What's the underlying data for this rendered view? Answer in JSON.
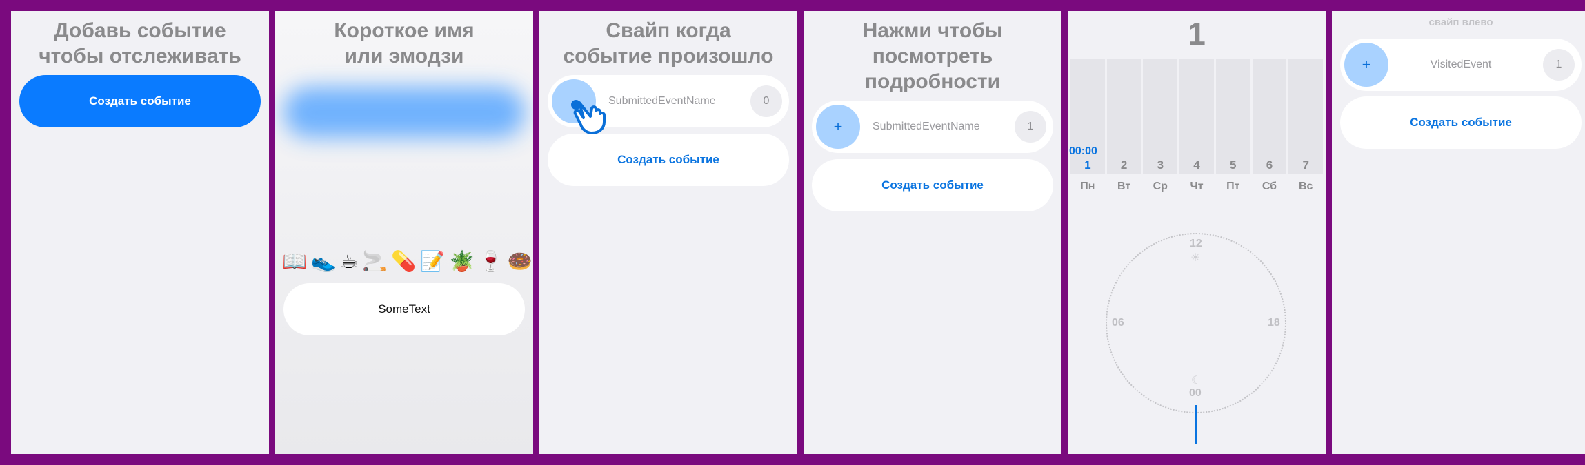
{
  "panel1": {
    "title_line1": "Добавь событие",
    "title_line2": "чтобы отслеживать",
    "create_button": "Создать событие"
  },
  "panel2": {
    "title_line1": "Короткое имя",
    "title_line2": "или эмодзи",
    "emojis": "📖👟☕🚬💊📝🪴🍷🍩",
    "input_value": "SomeText"
  },
  "panel3": {
    "title_line1": "Свайп когда",
    "title_line2": "событие произошло",
    "event_name": "SubmittedEventName",
    "event_count": "0",
    "create_button": "Создать событие"
  },
  "panel4": {
    "title_line1": "Нажми чтобы",
    "title_line2": "посмотреть",
    "title_line3": "подробности",
    "event_icon": "+",
    "event_name": "SubmittedEventName",
    "event_count": "1",
    "create_button": "Создать событие"
  },
  "panel5": {
    "total": "1",
    "time_label": "00:00",
    "days": [
      "1",
      "2",
      "3",
      "4",
      "5",
      "6",
      "7"
    ],
    "day_names": [
      "Пн",
      "Вт",
      "Ср",
      "Чт",
      "Пт",
      "Сб",
      "Вс"
    ],
    "clock": {
      "top": "12",
      "left": "06",
      "right": "18",
      "bottom": "00"
    }
  },
  "panel6": {
    "hint": "свайп влево",
    "event_icon": "+",
    "event_name": "VisitedEvent",
    "event_count": "1",
    "create_button": "Создать событие"
  },
  "colors": {
    "accent": "#0a7bff",
    "frame": "#7a0a7e",
    "circle": "#a9d2ff"
  }
}
